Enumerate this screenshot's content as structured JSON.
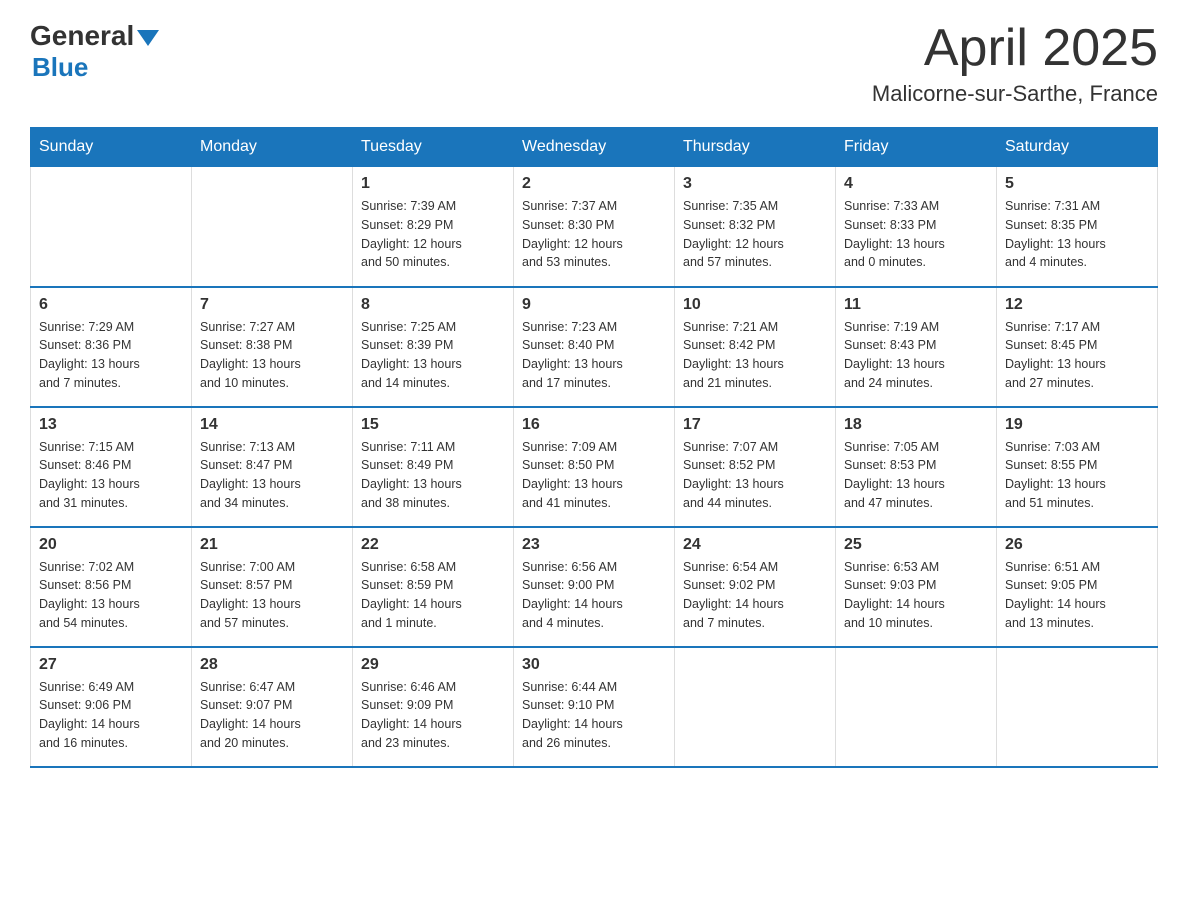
{
  "header": {
    "logo_general": "General",
    "logo_blue": "Blue",
    "month": "April 2025",
    "location": "Malicorne-sur-Sarthe, France"
  },
  "weekdays": [
    "Sunday",
    "Monday",
    "Tuesday",
    "Wednesday",
    "Thursday",
    "Friday",
    "Saturday"
  ],
  "weeks": [
    [
      {
        "day": "",
        "info": ""
      },
      {
        "day": "",
        "info": ""
      },
      {
        "day": "1",
        "info": "Sunrise: 7:39 AM\nSunset: 8:29 PM\nDaylight: 12 hours\nand 50 minutes."
      },
      {
        "day": "2",
        "info": "Sunrise: 7:37 AM\nSunset: 8:30 PM\nDaylight: 12 hours\nand 53 minutes."
      },
      {
        "day": "3",
        "info": "Sunrise: 7:35 AM\nSunset: 8:32 PM\nDaylight: 12 hours\nand 57 minutes."
      },
      {
        "day": "4",
        "info": "Sunrise: 7:33 AM\nSunset: 8:33 PM\nDaylight: 13 hours\nand 0 minutes."
      },
      {
        "day": "5",
        "info": "Sunrise: 7:31 AM\nSunset: 8:35 PM\nDaylight: 13 hours\nand 4 minutes."
      }
    ],
    [
      {
        "day": "6",
        "info": "Sunrise: 7:29 AM\nSunset: 8:36 PM\nDaylight: 13 hours\nand 7 minutes."
      },
      {
        "day": "7",
        "info": "Sunrise: 7:27 AM\nSunset: 8:38 PM\nDaylight: 13 hours\nand 10 minutes."
      },
      {
        "day": "8",
        "info": "Sunrise: 7:25 AM\nSunset: 8:39 PM\nDaylight: 13 hours\nand 14 minutes."
      },
      {
        "day": "9",
        "info": "Sunrise: 7:23 AM\nSunset: 8:40 PM\nDaylight: 13 hours\nand 17 minutes."
      },
      {
        "day": "10",
        "info": "Sunrise: 7:21 AM\nSunset: 8:42 PM\nDaylight: 13 hours\nand 21 minutes."
      },
      {
        "day": "11",
        "info": "Sunrise: 7:19 AM\nSunset: 8:43 PM\nDaylight: 13 hours\nand 24 minutes."
      },
      {
        "day": "12",
        "info": "Sunrise: 7:17 AM\nSunset: 8:45 PM\nDaylight: 13 hours\nand 27 minutes."
      }
    ],
    [
      {
        "day": "13",
        "info": "Sunrise: 7:15 AM\nSunset: 8:46 PM\nDaylight: 13 hours\nand 31 minutes."
      },
      {
        "day": "14",
        "info": "Sunrise: 7:13 AM\nSunset: 8:47 PM\nDaylight: 13 hours\nand 34 minutes."
      },
      {
        "day": "15",
        "info": "Sunrise: 7:11 AM\nSunset: 8:49 PM\nDaylight: 13 hours\nand 38 minutes."
      },
      {
        "day": "16",
        "info": "Sunrise: 7:09 AM\nSunset: 8:50 PM\nDaylight: 13 hours\nand 41 minutes."
      },
      {
        "day": "17",
        "info": "Sunrise: 7:07 AM\nSunset: 8:52 PM\nDaylight: 13 hours\nand 44 minutes."
      },
      {
        "day": "18",
        "info": "Sunrise: 7:05 AM\nSunset: 8:53 PM\nDaylight: 13 hours\nand 47 minutes."
      },
      {
        "day": "19",
        "info": "Sunrise: 7:03 AM\nSunset: 8:55 PM\nDaylight: 13 hours\nand 51 minutes."
      }
    ],
    [
      {
        "day": "20",
        "info": "Sunrise: 7:02 AM\nSunset: 8:56 PM\nDaylight: 13 hours\nand 54 minutes."
      },
      {
        "day": "21",
        "info": "Sunrise: 7:00 AM\nSunset: 8:57 PM\nDaylight: 13 hours\nand 57 minutes."
      },
      {
        "day": "22",
        "info": "Sunrise: 6:58 AM\nSunset: 8:59 PM\nDaylight: 14 hours\nand 1 minute."
      },
      {
        "day": "23",
        "info": "Sunrise: 6:56 AM\nSunset: 9:00 PM\nDaylight: 14 hours\nand 4 minutes."
      },
      {
        "day": "24",
        "info": "Sunrise: 6:54 AM\nSunset: 9:02 PM\nDaylight: 14 hours\nand 7 minutes."
      },
      {
        "day": "25",
        "info": "Sunrise: 6:53 AM\nSunset: 9:03 PM\nDaylight: 14 hours\nand 10 minutes."
      },
      {
        "day": "26",
        "info": "Sunrise: 6:51 AM\nSunset: 9:05 PM\nDaylight: 14 hours\nand 13 minutes."
      }
    ],
    [
      {
        "day": "27",
        "info": "Sunrise: 6:49 AM\nSunset: 9:06 PM\nDaylight: 14 hours\nand 16 minutes."
      },
      {
        "day": "28",
        "info": "Sunrise: 6:47 AM\nSunset: 9:07 PM\nDaylight: 14 hours\nand 20 minutes."
      },
      {
        "day": "29",
        "info": "Sunrise: 6:46 AM\nSunset: 9:09 PM\nDaylight: 14 hours\nand 23 minutes."
      },
      {
        "day": "30",
        "info": "Sunrise: 6:44 AM\nSunset: 9:10 PM\nDaylight: 14 hours\nand 26 minutes."
      },
      {
        "day": "",
        "info": ""
      },
      {
        "day": "",
        "info": ""
      },
      {
        "day": "",
        "info": ""
      }
    ]
  ]
}
